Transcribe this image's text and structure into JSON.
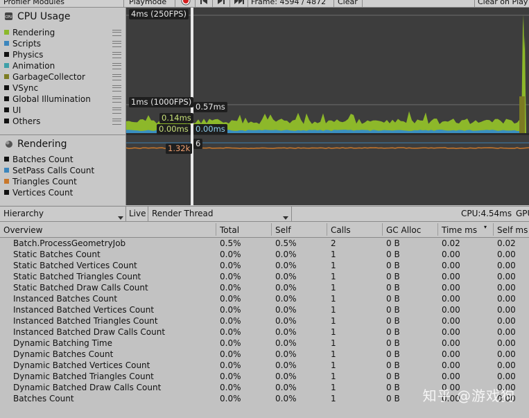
{
  "toolbar": {
    "modules_label": "Profiler Modules",
    "playmode_label": "Playmode",
    "frame_label": "Frame: 4594 / 4872",
    "clear_label": "Clear",
    "clear_on_play_label": "Clear on Play"
  },
  "cpu_module": {
    "title": "CPU Usage",
    "items": [
      {
        "label": "Rendering",
        "color": "#8bb82b"
      },
      {
        "label": "Scripts",
        "color": "#3c86bd"
      },
      {
        "label": "Physics",
        "color": "#111111"
      },
      {
        "label": "Animation",
        "color": "#3fa0a8"
      },
      {
        "label": "GarbageCollector",
        "color": "#7d7d24"
      },
      {
        "label": "VSync",
        "color": "#111111"
      },
      {
        "label": "Global Illumination",
        "color": "#111111"
      },
      {
        "label": "UI",
        "color": "#111111"
      },
      {
        "label": "Others",
        "color": "#111111"
      }
    ]
  },
  "rendering_module": {
    "title": "Rendering",
    "items": [
      {
        "label": "Batches Count",
        "color": "#111111"
      },
      {
        "label": "SetPass Calls Count",
        "color": "#3c86bd"
      },
      {
        "label": "Triangles Count",
        "color": "#c8772b"
      },
      {
        "label": "Vertices Count",
        "color": "#111111"
      }
    ]
  },
  "chart_labels": {
    "top_line": "4ms (250FPS)",
    "mid_line": "1ms (1000FPS)",
    "v1": "0.57ms",
    "v2": "0.14ms",
    "v3": "0.00ms",
    "v4": "0.00ms",
    "r1": "1.32k",
    "r2": "6"
  },
  "detail_bar": {
    "view_label": "Hierarchy",
    "live_label": "Live",
    "thread_label": "Render Thread",
    "cpu_label": "CPU:4.54ms",
    "gpu_label": "GPU"
  },
  "table": {
    "headers": [
      "Overview",
      "Total",
      "Self",
      "Calls",
      "GC Alloc",
      "Time ms",
      "Self ms"
    ],
    "rows": [
      [
        "Batch.ProcessGeometryJob",
        "0.5%",
        "0.5%",
        "2",
        "0 B",
        "0.02",
        "0.02"
      ],
      [
        "Static Batches Count",
        "0.0%",
        "0.0%",
        "1",
        "0 B",
        "0.00",
        "0.00"
      ],
      [
        "Static Batched Vertices Count",
        "0.0%",
        "0.0%",
        "1",
        "0 B",
        "0.00",
        "0.00"
      ],
      [
        "Static Batched Triangles Count",
        "0.0%",
        "0.0%",
        "1",
        "0 B",
        "0.00",
        "0.00"
      ],
      [
        "Static Batched Draw Calls Count",
        "0.0%",
        "0.0%",
        "1",
        "0 B",
        "0.00",
        "0.00"
      ],
      [
        "Instanced Batches Count",
        "0.0%",
        "0.0%",
        "1",
        "0 B",
        "0.00",
        "0.00"
      ],
      [
        "Instanced Batched Vertices Count",
        "0.0%",
        "0.0%",
        "1",
        "0 B",
        "0.00",
        "0.00"
      ],
      [
        "Instanced Batched Triangles Count",
        "0.0%",
        "0.0%",
        "1",
        "0 B",
        "0.00",
        "0.00"
      ],
      [
        "Instanced Batched Draw Calls Count",
        "0.0%",
        "0.0%",
        "1",
        "0 B",
        "0.00",
        "0.00"
      ],
      [
        "Dynamic Batching Time",
        "0.0%",
        "0.0%",
        "1",
        "0 B",
        "0.00",
        "0.00"
      ],
      [
        "Dynamic Batches Count",
        "0.0%",
        "0.0%",
        "1",
        "0 B",
        "0.00",
        "0.00"
      ],
      [
        "Dynamic Batched Vertices Count",
        "0.0%",
        "0.0%",
        "1",
        "0 B",
        "0.00",
        "0.00"
      ],
      [
        "Dynamic Batched Triangles Count",
        "0.0%",
        "0.0%",
        "1",
        "0 B",
        "0.00",
        "0.00"
      ],
      [
        "Dynamic Batched Draw Calls Count",
        "0.0%",
        "0.0%",
        "1",
        "0 B",
        "0.00",
        "0.00"
      ],
      [
        "Batches Count",
        "0.0%",
        "0.0%",
        "1",
        "0 B",
        "0.00",
        "0.00"
      ]
    ]
  },
  "watermark": "知乎 @游戏狗"
}
